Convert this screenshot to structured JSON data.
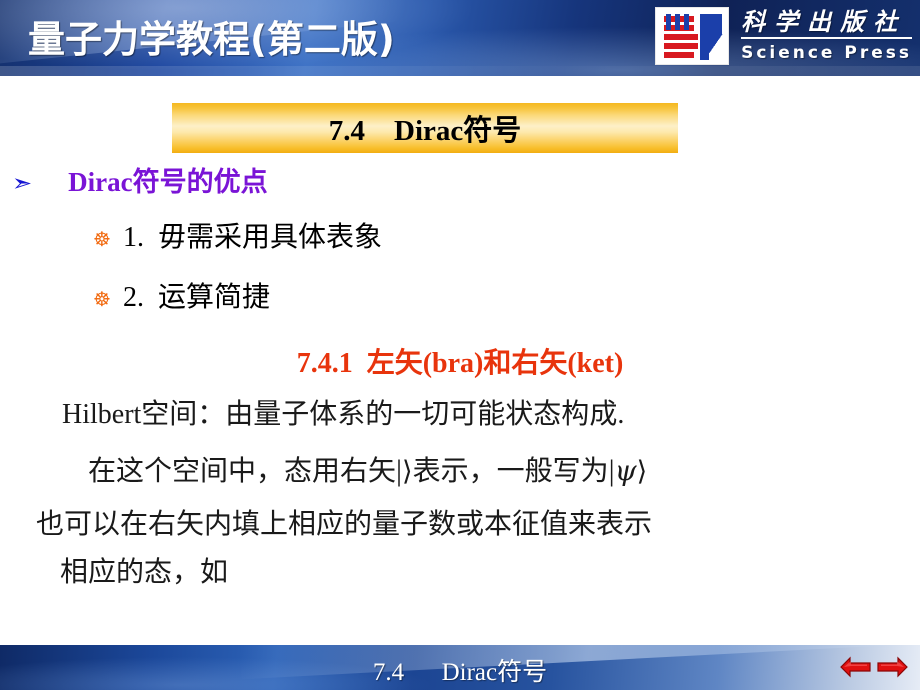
{
  "header": {
    "course_title": "量子力学教程(第二版)",
    "publisher": {
      "logo_icon": "science-press-logo-icon",
      "name_cn": "科学出版社",
      "name_en": "Science Press"
    }
  },
  "title_banner": {
    "text": "7.4    Dirac符号"
  },
  "content": {
    "advantages_bullet_icon": "arrow-right-bullet-icon",
    "advantages_heading": "Dirac符号的优点",
    "items": [
      {
        "bullet_icon": "dharma-wheel-bullet-icon",
        "text": "1.  毋需采用具体表象"
      },
      {
        "bullet_icon": "dharma-wheel-bullet-icon",
        "text": "2.  运算简捷"
      }
    ],
    "section_heading": "7.4.1  左矢(bra)和右矢(ket)",
    "paragraphs": {
      "line1": "Hilbert空间：由量子体系的一切可能状态构成.",
      "line2_before": "在这个空间中，态用右矢",
      "line2_empty_ket": "| ⟩",
      "line2_middle": "表示，一般写为",
      "line2_psi_ket": "|ψ⟩",
      "line3": "也可以在右矢内填上相应的量子数或本征值来表示",
      "line4": "相应的态，如"
    }
  },
  "footer": {
    "title": "7.4      Dirac符号",
    "nav": [
      {
        "icon": "arrow-left-icon",
        "name": "previous-slide"
      },
      {
        "icon": "arrow-right-icon",
        "name": "next-slide"
      }
    ]
  },
  "colors": {
    "header_blue": "#1d47a0",
    "banner_gold": "#fbd978",
    "heading_purple": "#7a14d6",
    "section_red": "#e8340c",
    "bullet_orange": "#f26a10",
    "arrow_blue": "#1414d2",
    "nav_red": "#d80f0f"
  }
}
